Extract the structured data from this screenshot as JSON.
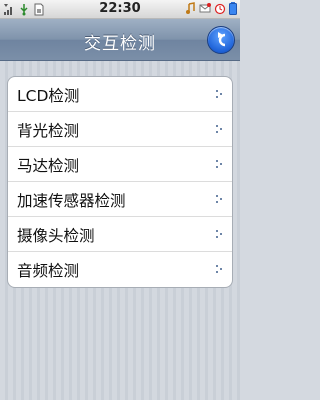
{
  "status_bar": {
    "time": "22:30",
    "left_icons": [
      "signal-icon",
      "usb-icon",
      "sim-card-icon"
    ],
    "right_icons": [
      "music-note-icon",
      "mail-icon",
      "alarm-icon",
      "battery-icon"
    ]
  },
  "header": {
    "title": "交互检测",
    "back_icon": "back-arrow-icon"
  },
  "list": {
    "items": [
      {
        "label": "LCD检测"
      },
      {
        "label": "背光检测"
      },
      {
        "label": "马达检测"
      },
      {
        "label": "加速传感器检测"
      },
      {
        "label": "摄像头检测"
      },
      {
        "label": "音频检测"
      }
    ]
  },
  "colors": {
    "title_bar": "#7f93ab",
    "back_button": "#1f63d8",
    "background": "#d3d8df",
    "row_indicator": "#6e86a8"
  }
}
